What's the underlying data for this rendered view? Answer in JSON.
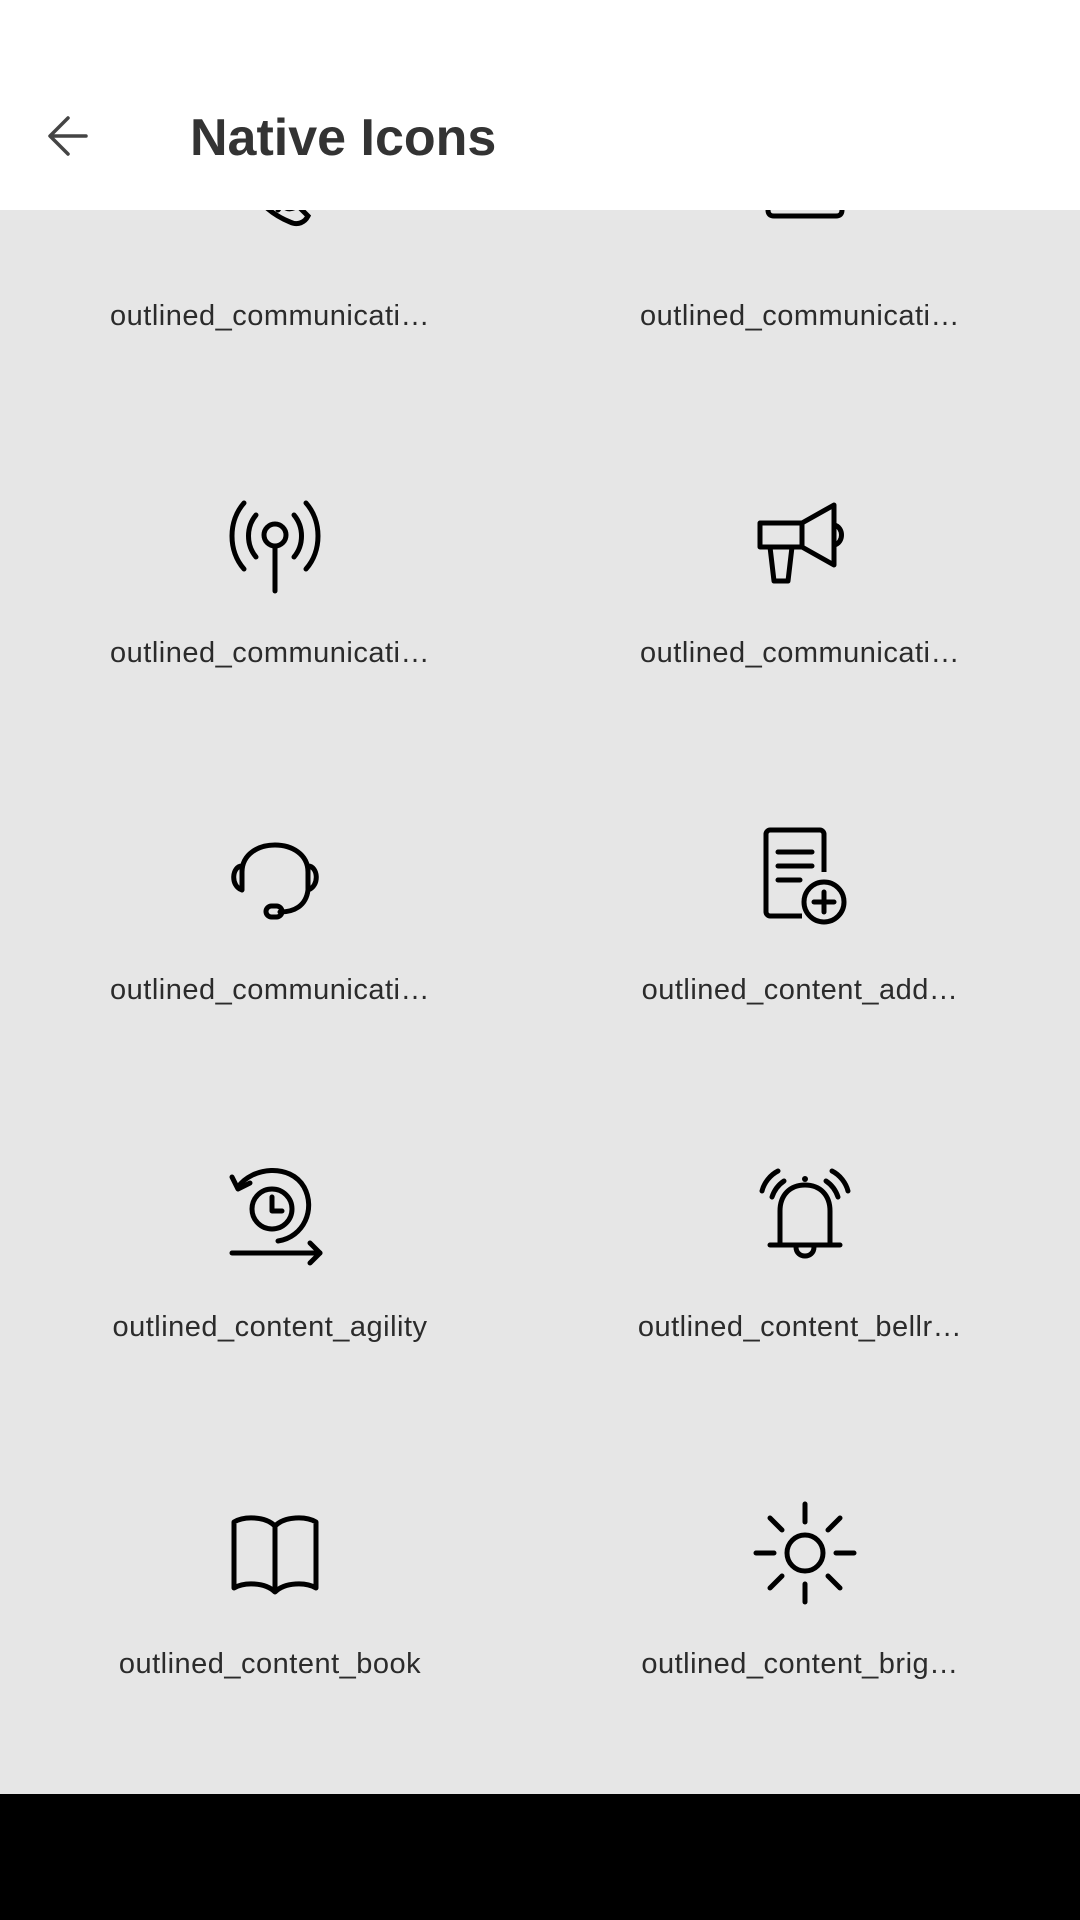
{
  "header": {
    "title": "Native Icons"
  },
  "icons": [
    {
      "label": "outlined_communicati…",
      "icon": "phone-icon"
    },
    {
      "label": "outlined_communicati…",
      "icon": "screen-icon"
    },
    {
      "label": "outlined_communicati…",
      "icon": "broadcast-icon"
    },
    {
      "label": "outlined_communicati…",
      "icon": "megaphone-icon"
    },
    {
      "label": "outlined_communicati…",
      "icon": "headset-icon"
    },
    {
      "label": "outlined_content_add…",
      "icon": "document-add-icon"
    },
    {
      "label": "outlined_content_agility",
      "icon": "agility-clock-icon"
    },
    {
      "label": "outlined_content_bellr…",
      "icon": "bell-ringing-icon"
    },
    {
      "label": "outlined_content_book",
      "icon": "book-icon"
    },
    {
      "label": "outlined_content_brig…",
      "icon": "brightness-icon"
    }
  ],
  "colors": {
    "background": "#e6e6e6",
    "header": "#ffffff",
    "text": "#2b2b2b",
    "navbar": "#000000"
  }
}
